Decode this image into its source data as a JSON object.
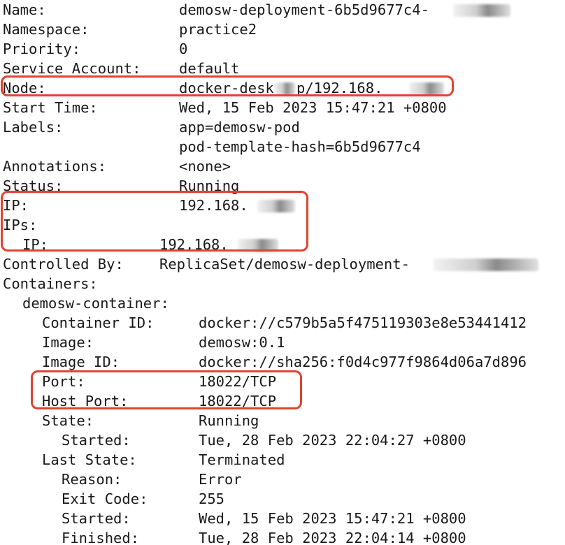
{
  "describe": {
    "name": {
      "key": "Name:",
      "value": "demosw-deployment-6b5d9677c4-"
    },
    "namespace": {
      "key": "Namespace:",
      "value": "practice2"
    },
    "priority": {
      "key": "Priority:",
      "value": "0"
    },
    "service_account": {
      "key": "Service Account:",
      "value": "default"
    },
    "node": {
      "key": "Node:",
      "value": "docker-desk",
      "value_tail": "p/192.168."
    },
    "start_time": {
      "key": "Start Time:",
      "value": "Wed, 15 Feb 2023 15:47:21 +0800"
    },
    "labels": {
      "key": "Labels:",
      "values": [
        "app=demosw-pod",
        "pod-template-hash=6b5d9677c4"
      ]
    },
    "annotations": {
      "key": "Annotations:",
      "value": "<none>"
    },
    "status": {
      "key": "Status:",
      "value": "Running"
    },
    "ip": {
      "key": "IP:",
      "value": "192.168."
    },
    "ips": {
      "key": "IPs:"
    },
    "ips_ip": {
      "key": "IP:",
      "value": "192.168."
    },
    "controlled_by": {
      "key": "Controlled By:",
      "value": "ReplicaSet/demosw-deployment-"
    },
    "containers": {
      "key": "Containers:"
    },
    "container": {
      "name": "demosw-container:",
      "container_id": {
        "key": "Container ID:",
        "value": "docker://c579b5a5f475119303e8e53441412"
      },
      "image": {
        "key": "Image:",
        "value": "demosw:0.1"
      },
      "image_id": {
        "key": "Image ID:",
        "value": "docker://sha256:f0d4c977f9864d06a7d896"
      },
      "port": {
        "key": "Port:",
        "value": "18022/TCP"
      },
      "host_port": {
        "key": "Host Port:",
        "value": "18022/TCP"
      },
      "state": {
        "key": "State:",
        "value": "Running"
      },
      "state_started": {
        "key": "Started:",
        "value": "Tue, 28 Feb 2023 22:04:27 +0800"
      },
      "last_state": {
        "key": "Last State:",
        "value": "Terminated"
      },
      "reason": {
        "key": "Reason:",
        "value": "Error"
      },
      "exit_code": {
        "key": "Exit Code:",
        "value": "255"
      },
      "last_started": {
        "key": "Started:",
        "value": "Wed, 15 Feb 2023 15:47:21 +0800"
      },
      "finished": {
        "key": "Finished:",
        "value": "Tue, 28 Feb 2023 22:04:14 +0800"
      }
    }
  },
  "highlight_color": "#e0432f"
}
